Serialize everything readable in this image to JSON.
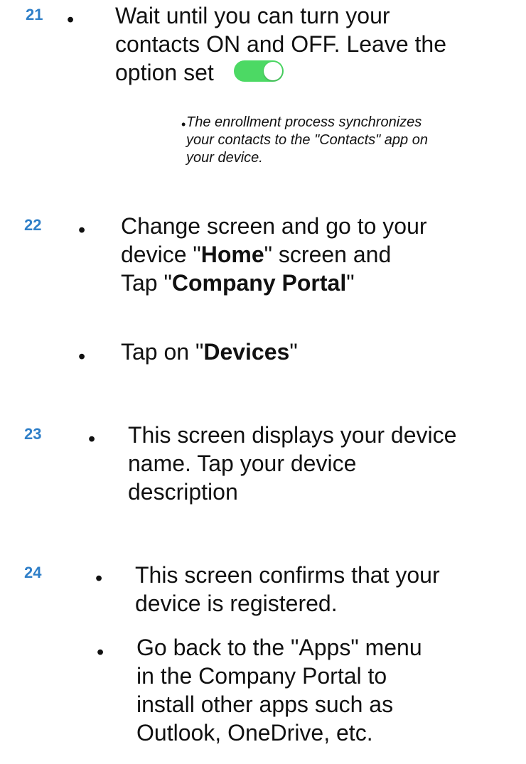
{
  "steps": [
    {
      "number": "21",
      "bullets": [
        {
          "lines": [
            "Wait until you can turn your",
            "contacts ON and OFF. Leave the",
            "option set"
          ],
          "toggle_state": "on"
        }
      ],
      "sub_bullets": [
        {
          "lines": [
            "The enrollment process synchronizes",
            "your contacts to the \"Contacts\" app on",
            "your device."
          ]
        }
      ]
    },
    {
      "number": "22",
      "bullets": [
        {
          "l1": "Change screen and go to your",
          "l2_pre": "device \"",
          "l2_bold": "Home",
          "l2_post": "\" screen and",
          "l3_pre": "Tap \"",
          "l3_bold": "Company Portal",
          "l3_post": "\""
        },
        {
          "pre": "Tap on \"",
          "bold": "Devices",
          "post": "\""
        }
      ]
    },
    {
      "number": "23",
      "bullets": [
        {
          "lines": [
            "This screen displays your device",
            "name. Tap your device",
            "description"
          ]
        }
      ]
    },
    {
      "number": "24",
      "bullets": [
        {
          "lines": [
            "This screen confirms that your",
            "device is registered."
          ]
        },
        {
          "lines": [
            "Go back to the \"Apps\" menu",
            "in the Company Portal to",
            "install other apps such as",
            "Outlook, OneDrive, etc."
          ]
        }
      ]
    }
  ],
  "bullet_glyph": "•",
  "colors": {
    "step_number": "#2f7fc8",
    "toggle_on": "#4cd964",
    "text": "#111111"
  }
}
